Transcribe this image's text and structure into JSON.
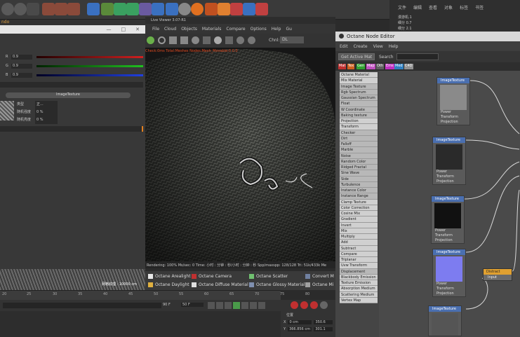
{
  "top_right_menu": [
    "文件",
    "编辑",
    "查看",
    "对象",
    "标签",
    "书签"
  ],
  "top_right_objects": [
    "漫游机.1",
    "细分 0.7",
    "细分 2.1"
  ],
  "left_panel": {
    "title": "ndo",
    "window_buttons": [
      "—",
      "□",
      "✕"
    ],
    "color_rows": [
      {
        "label": "R",
        "value": "0.9",
        "color": "#d02020"
      },
      {
        "label": "G",
        "value": "0.9",
        "color": "#20c020"
      },
      {
        "label": "B",
        "value": "0.9",
        "color": "#2040e0"
      }
    ],
    "image_texture_btn": "ImageTexture",
    "texture_params": [
      {
        "label": "类型",
        "value": "正..."
      },
      {
        "label": "随机强度",
        "value": "0 %"
      },
      {
        "label": "随机亮度",
        "value": "0 %"
      }
    ],
    "fabric_label": "网格纹理 : 10000 cm"
  },
  "timeline": {
    "ticks": [
      "20",
      "25",
      "30",
      "35",
      "40",
      "45",
      "50",
      "55",
      "60",
      "65",
      "70",
      "75",
      "80"
    ],
    "frame_field": "90 F",
    "end_field": "50 F"
  },
  "live_viewer": {
    "title": "Live Viewer 3.07-R1",
    "menu": [
      "File",
      "Cloud",
      "Objects",
      "Materials",
      "Compare",
      "Options",
      "Help",
      "Gu"
    ],
    "channel_label": "Chnl:",
    "channel_value": "DL",
    "render_overlay": "Check:0ms  Total:Meshes  Nodes:Mesh_Movable:0  0.0",
    "status": "Rendering: 100%  Ms/sec: 0  Time: 小时 : 分钟 : 秒/小时 : 分钟 : 秒  Spp/maxspp: 128/128  Tri: 51k/433k  Me"
  },
  "octane_toolbar": [
    {
      "label": "Octane Arealight",
      "color": "#e8e8e8"
    },
    {
      "label": "Octane Camera",
      "color": "#c03030"
    },
    {
      "label": "Octane Scatter",
      "color": "#70c070"
    },
    {
      "label": "Convert M",
      "color": "#7080a0"
    },
    {
      "label": "Octane Daylight",
      "color": "#e0b040"
    },
    {
      "label": "Octane Diffuse Material",
      "color": "#e0e0e0"
    },
    {
      "label": "Octane Glossy Material",
      "color": "#8090b0"
    },
    {
      "label": "Octane Mi",
      "color": "#a0a0a0"
    }
  ],
  "coords": {
    "header": "位置",
    "rows": [
      {
        "axis": "X",
        "pos": "0 cm",
        "val": "350.6"
      },
      {
        "axis": "Y",
        "pos": "366.856 cm",
        "val": "301.1"
      }
    ]
  },
  "node_editor": {
    "title": "Octane Node Editor",
    "menu": [
      "Edit",
      "Create",
      "View",
      "Help"
    ],
    "get_active": "Get Active Mat",
    "search_label": "Search",
    "tabs": [
      {
        "label": "Mat",
        "color": "#c03030"
      },
      {
        "label": "Tex",
        "color": "#d06020"
      },
      {
        "label": "Gen",
        "color": "#30a030"
      },
      {
        "label": "Map",
        "color": "#c050c0"
      },
      {
        "label": "Oth",
        "color": "#606060"
      },
      {
        "label": "Ems",
        "color": "#c030c0"
      },
      {
        "label": "Med",
        "color": "#3080c0"
      },
      {
        "label": "C4D",
        "color": "#909090"
      }
    ],
    "node_list": [
      "Octane Material",
      "Mix Material",
      "Image Texture",
      "Rgb Spectrum",
      "Gaussian Spectrum",
      "Float",
      "W Coordinate",
      "Baking texture",
      "Projection",
      "Transform",
      "Checker",
      "Dirt",
      "Falloff",
      "Marble",
      "Noise",
      "Random Color",
      "Ridged Fractal",
      "Sine Wave",
      "Side",
      "Turbulence",
      "Instance Color",
      "Instance Range",
      "Clamp Texture",
      "Color Correction",
      "Cosine Mix",
      "Gradient",
      "Invert",
      "Mix",
      "Multiply",
      "Add",
      "Subtract",
      "Compare",
      "Triplanar",
      "Uvw Transform",
      "Displacement",
      "Blackbody Emission",
      "Texture Emission",
      "Absorption Medium",
      "Scattering Medium",
      "Vertex Map"
    ],
    "image_nodes": [
      {
        "title": "ImageTexture",
        "preview": "#8a8a8a",
        "ports": [
          "Power",
          "Transform",
          "Projection"
        ]
      },
      {
        "title": "ImageTexture",
        "preview": "#2a2a2a",
        "ports": [
          "Power",
          "Transform",
          "Projection"
        ]
      },
      {
        "title": "ImageTexture",
        "preview": "#111111",
        "ports": [
          "Power",
          "Transform",
          "Projection"
        ]
      },
      {
        "title": "ImageTexture",
        "preview": "#7d7cf0",
        "ports": [
          "Power",
          "Transform",
          "Projection"
        ]
      },
      {
        "title": "ImageTexture",
        "preview": "#555555",
        "ports": []
      }
    ],
    "orange_node": {
      "title": "Distract",
      "port": "Input"
    }
  }
}
